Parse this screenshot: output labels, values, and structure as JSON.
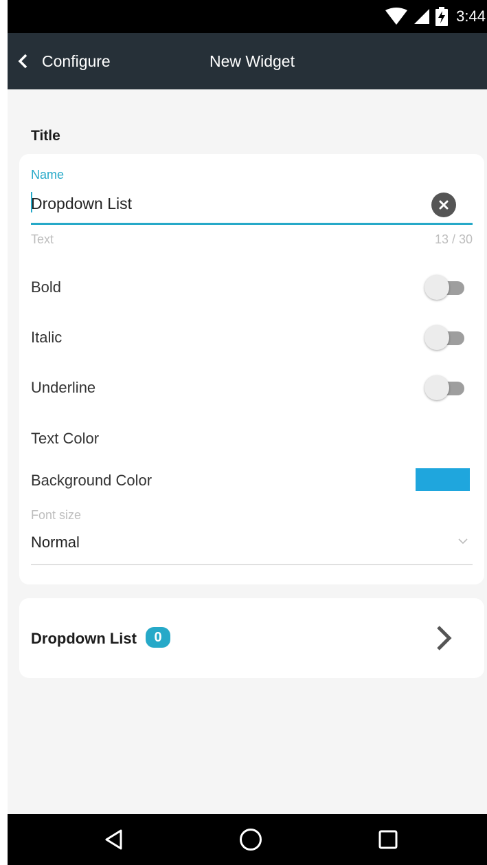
{
  "status_bar": {
    "time": "3:44",
    "icons": [
      "wifi-icon",
      "cell-signal-icon",
      "battery-charging-icon"
    ]
  },
  "app_bar": {
    "back_label": "Configure",
    "title": "New Widget"
  },
  "section": {
    "title": "Title"
  },
  "name_field": {
    "label": "Name",
    "value": "Dropdown List",
    "helper": "Text",
    "counter": "13 / 30"
  },
  "toggles": [
    {
      "label": "Bold",
      "on": false
    },
    {
      "label": "Italic",
      "on": false
    },
    {
      "label": "Underline",
      "on": false
    }
  ],
  "text_color": {
    "label": "Text Color"
  },
  "background_color": {
    "label": "Background Color",
    "value": "#1fa6dd"
  },
  "font_size": {
    "label": "Font size",
    "value": "Normal"
  },
  "dropdown_nav": {
    "label": "Dropdown List",
    "count": "0"
  },
  "colors": {
    "accent": "#26a9c8",
    "app_bar": "#263038",
    "background": "#f5f5f5"
  },
  "nav_bar": {
    "buttons": [
      "back-triangle-icon",
      "home-circle-icon",
      "recents-square-icon"
    ]
  }
}
